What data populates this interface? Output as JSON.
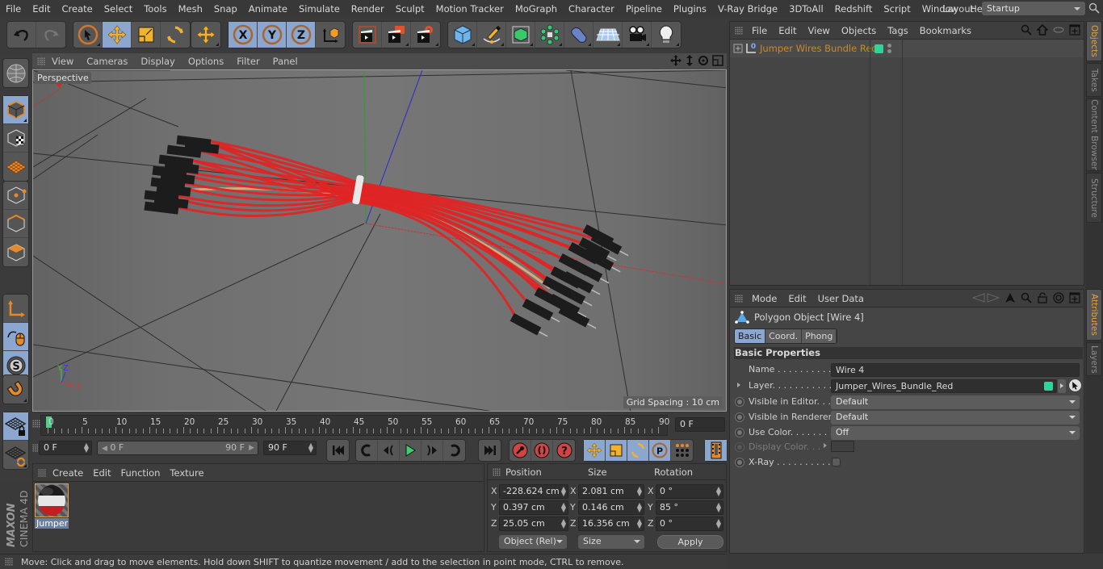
{
  "menubar": {
    "items": [
      "File",
      "Edit",
      "Create",
      "Select",
      "Tools",
      "Mesh",
      "Snap",
      "Animate",
      "Simulate",
      "Render",
      "Sculpt",
      "Motion Tracker",
      "MoGraph",
      "Character",
      "Pipeline",
      "Plugins",
      "V-Ray Bridge",
      "3DToAll",
      "Redshift",
      "Script",
      "Window",
      "Help"
    ],
    "layout_label": "Layout:",
    "layout_value": "Startup"
  },
  "toolbar": {
    "icons": [
      "undo-icon",
      "redo-icon",
      "live-selection-icon",
      "move-icon",
      "scale-icon",
      "rotate-icon",
      "recent-tool-icon",
      "x-axis-lock-icon",
      "y-axis-lock-icon",
      "z-axis-lock-icon",
      "coordinate-system-icon",
      "render-view-icon",
      "render-picture-viewer-icon",
      "render-settings-icon",
      "cube-primitive-icon",
      "pen-spline-icon",
      "subdivision-surface-icon",
      "cloner-icon",
      "deformer-icon",
      "floor-icon",
      "camera-icon",
      "light-icon"
    ]
  },
  "viewport": {
    "menu": [
      "View",
      "Cameras",
      "Display",
      "Options",
      "Filter",
      "Panel"
    ],
    "camera_label": "Perspective",
    "grid_spacing": "Grid Spacing : 10 cm",
    "axis_labels": {
      "x": "X",
      "y": "Y",
      "z": "Z"
    },
    "colors": {
      "wire": "#e02424",
      "connector": "#1c1c1c",
      "x_axis": "#d23a3a",
      "y_axis": "#3fb03f",
      "z_axis": "#2a2ad0"
    }
  },
  "left_tools": [
    "make-editable-icon",
    "model-mode-icon",
    "texture-mode-icon",
    "workplane-mode-icon",
    "points-mode-icon",
    "edges-mode-icon",
    "polygons-mode-icon",
    "axis-mode-icon",
    "tweak-mode-icon",
    "solo-mode-icon",
    "snap-icon",
    "lock-workplane-icon",
    "workplane-align-icon"
  ],
  "timeline": {
    "ticks": [
      "0",
      "5",
      "10",
      "15",
      "20",
      "25",
      "30",
      "35",
      "40",
      "45",
      "50",
      "55",
      "60",
      "65",
      "70",
      "75",
      "80",
      "85",
      "90"
    ],
    "current_frame_display": "0 F",
    "start_field": "0 F",
    "range_start": "0 F",
    "range_end": "90 F",
    "end_field": "90 F",
    "current_frame": 0,
    "max_frame": 90
  },
  "transport": {
    "icons": [
      "go-to-start-icon",
      "prev-key-icon",
      "prev-frame-icon",
      "play-icon",
      "next-frame-icon",
      "next-key-icon",
      "go-to-end-icon",
      "record-icon",
      "autokey-icon",
      "keyframe-selection-icon",
      "move-key-icon",
      "scale-key-icon",
      "rotate-key-icon",
      "param-key-icon",
      "pla-key-icon",
      "timeline-window-icon"
    ]
  },
  "material_manager": {
    "menu": [
      "Create",
      "Edit",
      "Function",
      "Texture"
    ],
    "materials": [
      {
        "name": "Jumper"
      }
    ]
  },
  "coordinates": {
    "headers": [
      "Position",
      "Size",
      "Rotation"
    ],
    "rows": [
      {
        "axis": "X",
        "position": "-228.624 cm",
        "size_axis": "X",
        "size": "2.081 cm",
        "rot_axis": "X",
        "rotation": "0 °"
      },
      {
        "axis": "Y",
        "position": "0.397 cm",
        "size_axis": "Y",
        "size": "0.146 cm",
        "rot_axis": "Y",
        "rotation": "85 °"
      },
      {
        "axis": "Z",
        "position": "25.05 cm",
        "size_axis": "Z",
        "size": "16.356 cm",
        "rot_axis": "Z",
        "rotation": "0 °"
      }
    ],
    "mode_dropdown": "Object (Rel)",
    "size_dropdown": "Size",
    "apply_label": "Apply"
  },
  "status": {
    "text": "Move: Click and drag to move elements. Hold down SHIFT to quantize movement / add to the selection in point mode, CTRL to remove."
  },
  "brand": {
    "line1": "MAXON",
    "line2": "CINEMA 4D"
  },
  "object_manager": {
    "menu": [
      "File",
      "Edit",
      "View",
      "Objects",
      "Tags",
      "Bookmarks"
    ],
    "objects": [
      {
        "name": "Jumper Wires Bundle Red",
        "layer_color": "#2fd49a"
      }
    ]
  },
  "side_tabs": {
    "top": [
      "Objects",
      "Takes",
      "Content Browser",
      "Structure"
    ],
    "bottom": [
      "Attributes",
      "Layers"
    ]
  },
  "attributes": {
    "menu": [
      "Mode",
      "Edit",
      "User Data"
    ],
    "object_title": "Polygon Object [Wire 4]",
    "tabs": [
      "Basic",
      "Coord.",
      "Phong"
    ],
    "active_tab": "Basic",
    "section": "Basic Properties",
    "props": {
      "name_label": "Name . . . . . . . . . . . .",
      "name_value": "Wire 4",
      "layer_label": "Layer. . . . . . . . . . . . .",
      "layer_value": "Jumper_Wires_Bundle_Red",
      "layer_color": "#2fd49a",
      "vis_editor_label": "Visible in Editor. . .",
      "vis_editor_value": "Default",
      "vis_render_label": "Visible in Renderer",
      "vis_render_value": "Default",
      "use_color_label": "Use Color. . . . . . . .",
      "use_color_value": "Off",
      "display_color_label": "Display Color. . .",
      "xray_label": "X-Ray . . . . . . . . . . .",
      "xray_checked": false
    }
  }
}
